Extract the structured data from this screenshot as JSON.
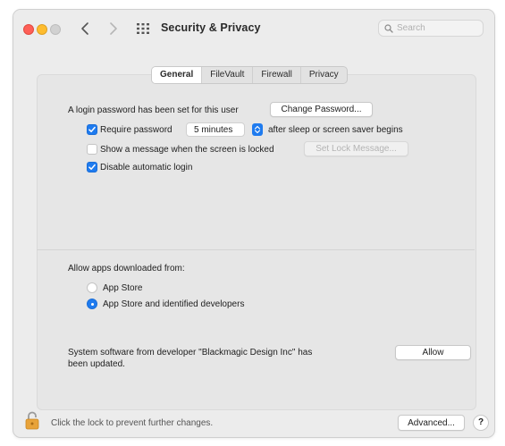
{
  "window": {
    "title": "Security & Privacy",
    "search_placeholder": "Search"
  },
  "tabs": [
    {
      "label": "General",
      "active": true
    },
    {
      "label": "FileVault",
      "active": false
    },
    {
      "label": "Firewall",
      "active": false
    },
    {
      "label": "Privacy",
      "active": false
    }
  ],
  "general": {
    "login_password_text": "A login password has been set for this user",
    "change_password_button": "Change Password...",
    "require_password_label": "Require password",
    "require_password_checked": true,
    "require_password_interval": "5 minutes",
    "require_password_suffix": "after sleep or screen saver begins",
    "show_message_label": "Show a message when the screen is locked",
    "show_message_checked": false,
    "set_lock_message_button": "Set Lock Message...",
    "disable_auto_login_label": "Disable automatic login",
    "disable_auto_login_checked": true
  },
  "downloads": {
    "heading": "Allow apps downloaded from:",
    "options": [
      {
        "label": "App Store",
        "selected": false
      },
      {
        "label": "App Store and identified developers",
        "selected": true
      }
    ]
  },
  "system_software": {
    "message_line1": "System software from developer \"Blackmagic Design Inc\" has",
    "message_line2": "been updated.",
    "allow_button": "Allow"
  },
  "footer": {
    "lock_text": "Click the lock to prevent further changes.",
    "advanced_button": "Advanced...",
    "help_button": "?"
  },
  "colors": {
    "accent": "#1f7bef",
    "close": "#fe5f57",
    "minimize": "#febc2e",
    "zoom_inactive": "#d1d1d1",
    "lock": "#e8a33a"
  }
}
